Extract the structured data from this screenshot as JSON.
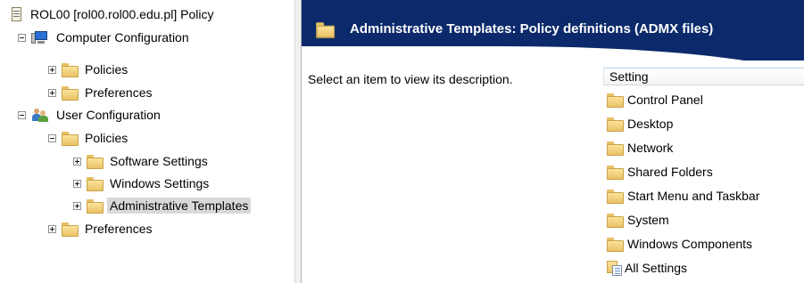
{
  "tree": {
    "root": {
      "label": "ROL00 [rol00.rol00.edu.pl] Policy"
    },
    "computer_config": {
      "label": "Computer Configuration",
      "children": {
        "policies": "Policies",
        "preferences": "Preferences"
      }
    },
    "user_config": {
      "label": "User Configuration",
      "policies": {
        "label": "Policies",
        "children": {
          "software_settings": "Software Settings",
          "windows_settings": "Windows Settings",
          "administrative_templates": "Administrative Templates"
        }
      },
      "preferences": "Preferences"
    }
  },
  "right_pane": {
    "title": "Administrative Templates: Policy definitions (ADMX files)",
    "description": "Select an item to view its description.",
    "column_header": "Setting",
    "items": [
      "Control Panel",
      "Desktop",
      "Network",
      "Shared Folders",
      "Start Menu and Taskbar",
      "System",
      "Windows Components",
      "All Settings"
    ]
  },
  "colors": {
    "header_bg": "#0c2a6b",
    "selection_bg": "#d9d9d9"
  },
  "icons": {
    "root": "policy-document-icon",
    "computer": "computer-icon",
    "user": "users-icon",
    "folder": "folder-icon",
    "all_settings": "all-settings-icon"
  }
}
